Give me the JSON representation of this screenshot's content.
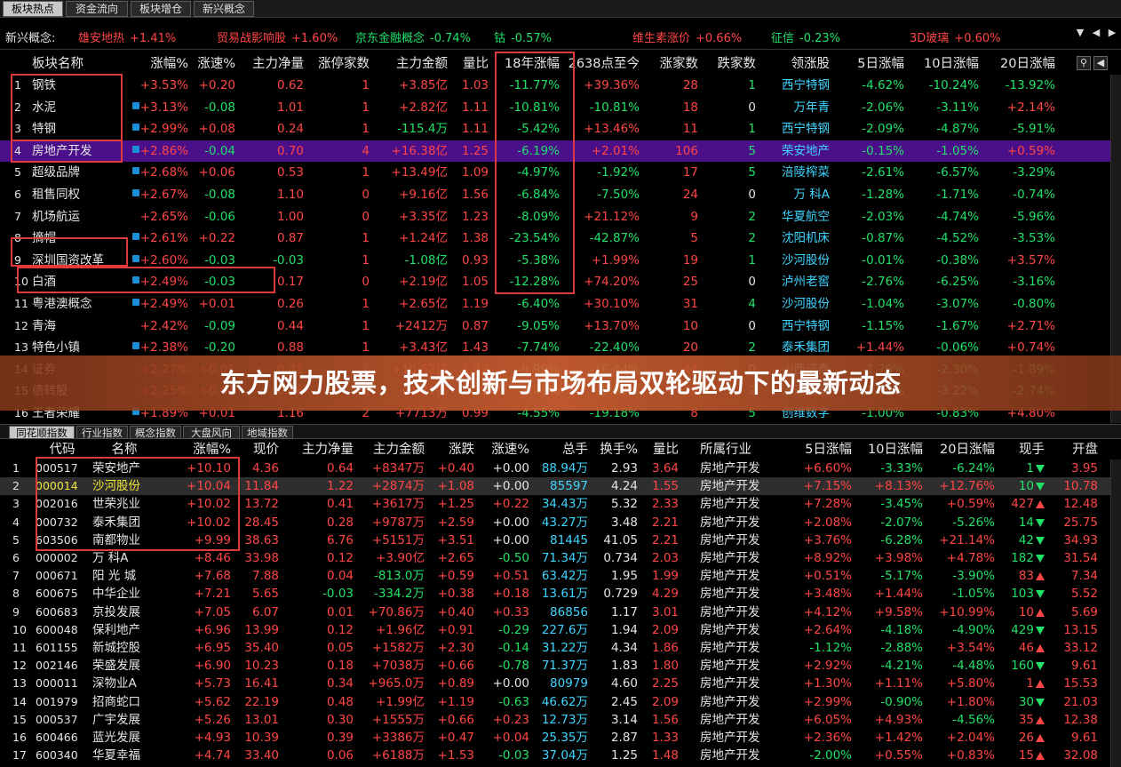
{
  "tabs": [
    "板块热点",
    "资金流向",
    "板块增仓",
    "新兴概念"
  ],
  "ticker": {
    "label": "新兴概念:",
    "items": [
      {
        "name": "雄安地热",
        "value": "+1.41%",
        "name_color": "#ff4646",
        "value_color": "#ff4646"
      },
      {
        "name": "贸易战影响股",
        "value": "+1.60%",
        "name_color": "#ff4646",
        "value_color": "#ff4646"
      },
      {
        "name": "京东金融概念",
        "value": "-0.74%",
        "name_color": "#22e06a",
        "value_color": "#22e06a"
      },
      {
        "name": "钴",
        "value": "-0.57%",
        "name_color": "#22e06a",
        "value_color": "#22e06a"
      },
      {
        "name": "维生素涨价",
        "value": "+0.66%",
        "name_color": "#ff4646",
        "value_color": "#ff4646"
      },
      {
        "name": "征信",
        "value": "-0.23%",
        "name_color": "#22e06a",
        "value_color": "#22e06a"
      },
      {
        "name": "3D玻璃",
        "value": "+0.60%",
        "name_color": "#ff4646",
        "value_color": "#ff4646"
      }
    ]
  },
  "top_headers": [
    "板块名称",
    "涨幅%",
    "涨速%",
    "主力净量",
    "涨停家数",
    "主力金额",
    "量比",
    "18年涨幅",
    "2638点至今",
    "涨家数",
    "跌家数",
    "领涨股",
    "5日涨幅",
    "10日涨幅",
    "20日涨幅"
  ],
  "top_rows": [
    {
      "n": "1",
      "name": "钢铁",
      "dot": false,
      "chg": "+3.53%",
      "spd": "+0.20",
      "net": "0.62",
      "lim": "1",
      "amt": "+3.85亿",
      "vr": "1.03",
      "y18": "-11.77%",
      "p2638": "+39.36%",
      "up": "28",
      "dn": "1",
      "lead": "西宁特钢",
      "d5": "-4.62%",
      "d10": "-10.24%",
      "d20": "-13.92%"
    },
    {
      "n": "2",
      "name": "水泥",
      "dot": true,
      "chg": "+3.13%",
      "spd": "-0.08",
      "net": "1.01",
      "lim": "1",
      "amt": "+2.82亿",
      "vr": "1.11",
      "y18": "-10.81%",
      "p2638": "-10.81%",
      "up": "18",
      "dn": "0",
      "lead": "万年青",
      "d5": "-2.06%",
      "d10": "-3.11%",
      "d20": "+2.14%"
    },
    {
      "n": "3",
      "name": "特钢",
      "dot": true,
      "chg": "+2.99%",
      "spd": "+0.08",
      "net": "0.24",
      "lim": "1",
      "amt": "-115.4万",
      "vr": "1.11",
      "y18": "-5.42%",
      "p2638": "+13.46%",
      "up": "11",
      "dn": "1",
      "lead": "西宁特钢",
      "d5": "-2.09%",
      "d10": "-4.87%",
      "d20": "-5.91%"
    },
    {
      "n": "4",
      "name": "房地产开发",
      "dot": true,
      "chg": "+2.86%",
      "spd": "-0.04",
      "net": "0.70",
      "lim": "4",
      "amt": "+16.38亿",
      "vr": "1.25",
      "y18": "-6.19%",
      "p2638": "+2.01%",
      "up": "106",
      "dn": "5",
      "lead": "荣安地产",
      "d5": "-0.15%",
      "d10": "-1.05%",
      "d20": "+0.59%"
    },
    {
      "n": "5",
      "name": "超级品牌",
      "dot": true,
      "chg": "+2.68%",
      "spd": "+0.06",
      "net": "0.53",
      "lim": "1",
      "amt": "+13.49亿",
      "vr": "1.09",
      "y18": "-4.97%",
      "p2638": "-1.92%",
      "up": "17",
      "dn": "5",
      "lead": "涪陵榨菜",
      "d5": "-2.61%",
      "d10": "-6.57%",
      "d20": "-3.29%"
    },
    {
      "n": "6",
      "name": "租售同权",
      "dot": true,
      "chg": "+2.67%",
      "spd": "-0.08",
      "net": "1.10",
      "lim": "0",
      "amt": "+9.16亿",
      "vr": "1.56",
      "y18": "-6.84%",
      "p2638": "-7.50%",
      "up": "24",
      "dn": "0",
      "lead": "万 科A",
      "d5": "-1.28%",
      "d10": "-1.71%",
      "d20": "-0.74%"
    },
    {
      "n": "7",
      "name": "机场航运",
      "dot": false,
      "chg": "+2.65%",
      "spd": "-0.06",
      "net": "1.00",
      "lim": "0",
      "amt": "+3.35亿",
      "vr": "1.23",
      "y18": "-8.09%",
      "p2638": "+21.12%",
      "up": "9",
      "dn": "2",
      "lead": "华夏航空",
      "d5": "-2.03%",
      "d10": "-4.74%",
      "d20": "-5.96%"
    },
    {
      "n": "8",
      "name": "摘帽",
      "dot": true,
      "chg": "+2.61%",
      "spd": "+0.22",
      "net": "0.87",
      "lim": "1",
      "amt": "+1.24亿",
      "vr": "1.38",
      "y18": "-23.54%",
      "p2638": "-42.87%",
      "up": "5",
      "dn": "2",
      "lead": "沈阳机床",
      "d5": "-0.87%",
      "d10": "-4.52%",
      "d20": "-3.53%"
    },
    {
      "n": "9",
      "name": "深圳国资改革",
      "dot": true,
      "chg": "+2.60%",
      "spd": "-0.03",
      "net": "-0.03",
      "lim": "1",
      "amt": "-1.08亿",
      "vr": "0.93",
      "y18": "-5.38%",
      "p2638": "+1.99%",
      "up": "19",
      "dn": "1",
      "lead": "沙河股份",
      "d5": "-0.01%",
      "d10": "-0.38%",
      "d20": "+3.57%"
    },
    {
      "n": "10",
      "name": "白酒",
      "dot": true,
      "chg": "+2.49%",
      "spd": "-0.03",
      "net": "0.17",
      "lim": "0",
      "amt": "+2.19亿",
      "vr": "1.05",
      "y18": "-12.28%",
      "p2638": "+74.20%",
      "up": "25",
      "dn": "0",
      "lead": "泸州老窖",
      "d5": "-2.76%",
      "d10": "-6.25%",
      "d20": "-3.16%"
    },
    {
      "n": "11",
      "name": "粤港澳概念",
      "dot": true,
      "chg": "+2.49%",
      "spd": "+0.01",
      "net": "0.26",
      "lim": "1",
      "amt": "+2.65亿",
      "vr": "1.19",
      "y18": "-6.40%",
      "p2638": "+30.10%",
      "up": "31",
      "dn": "4",
      "lead": "沙河股份",
      "d5": "-1.04%",
      "d10": "-3.07%",
      "d20": "-0.80%"
    },
    {
      "n": "12",
      "name": "青海",
      "dot": false,
      "chg": "+2.42%",
      "spd": "-0.09",
      "net": "0.44",
      "lim": "1",
      "amt": "+2412万",
      "vr": "0.87",
      "y18": "-9.05%",
      "p2638": "+13.70%",
      "up": "10",
      "dn": "0",
      "lead": "西宁特钢",
      "d5": "-1.15%",
      "d10": "-1.67%",
      "d20": "+2.71%"
    },
    {
      "n": "13",
      "name": "特色小镇",
      "dot": true,
      "chg": "+2.38%",
      "spd": "-0.20",
      "net": "0.88",
      "lim": "1",
      "amt": "+3.43亿",
      "vr": "1.43",
      "y18": "-7.74%",
      "p2638": "-22.40%",
      "up": "20",
      "dn": "2",
      "lead": "泰禾集团",
      "d5": "+1.44%",
      "d10": "-0.06%",
      "d20": "+0.74%"
    },
    {
      "n": "14",
      "name": "证券",
      "dot": false,
      "chg": "+2.27%",
      "spd": "+0.01",
      "net": "0.41",
      "lim": "1",
      "amt": "+10.52亿",
      "vr": "1.32",
      "y18": "-9.99%",
      "p2638": "-16.44%",
      "up": "44",
      "dn": "0",
      "lead": "山西证券",
      "d5": "-1.70%",
      "d10": "-2.30%",
      "d20": "-1.89%"
    },
    {
      "n": "15",
      "name": "债转股",
      "dot": false,
      "chg": "+2.25%",
      "spd": "+0.01",
      "net": "0.56",
      "lim": "1",
      "amt": "+4.21亿",
      "vr": "1.21",
      "y18": "-8.41%",
      "p2638": "-5.67%",
      "up": "30",
      "dn": "2",
      "lead": "沙河股份",
      "d5": "-1.85%",
      "d10": "-3.22%",
      "d20": "-2.74%"
    },
    {
      "n": "16",
      "name": "王者荣耀",
      "dot": true,
      "chg": "+1.89%",
      "spd": "+0.01",
      "net": "1.16",
      "lim": "2",
      "amt": "+7713万",
      "vr": "0.99",
      "y18": "-4.55%",
      "p2638": "-19.18%",
      "up": "8",
      "dn": "5",
      "lead": "创维数字",
      "d5": "-1.00%",
      "d10": "-0.83%",
      "d20": "+4.80%"
    }
  ],
  "bottom_tabs": [
    "同花顺指数",
    "行业指数",
    "概念指数",
    "大盘风向",
    "地域指数"
  ],
  "bottom_headers": [
    "代码",
    "名称",
    "涨幅%",
    "现价",
    "主力净量",
    "主力金额",
    "涨跌",
    "涨速%",
    "总手",
    "换手%",
    "量比",
    "所属行业",
    "5日涨幅",
    "10日涨幅",
    "20日涨幅",
    "现手",
    "开盘"
  ],
  "bottom_rows": [
    {
      "n": "1",
      "code": "000517",
      "name": "荣安地产",
      "chg": "+10.10",
      "price": "4.36",
      "net": "0.64",
      "amt": "+8347万",
      "diff": "+0.40",
      "spd": "+0.00",
      "vol": "88.94万",
      "turn": "2.93",
      "vr": "3.64",
      "ind": "房地产开发",
      "d5": "+6.60%",
      "d10": "-3.33%",
      "d20": "-6.24%",
      "hand": "1",
      "dir": "down",
      "open": "3.95"
    },
    {
      "n": "2",
      "code": "000014",
      "name": "沙河股份",
      "chg": "+10.04",
      "price": "11.84",
      "net": "1.22",
      "amt": "+2874万",
      "diff": "+1.08",
      "spd": "+0.00",
      "vol": "85597",
      "turn": "4.24",
      "vr": "1.55",
      "ind": "房地产开发",
      "d5": "+7.15%",
      "d10": "+8.13%",
      "d20": "+12.76%",
      "hand": "10",
      "dir": "down",
      "open": "10.78"
    },
    {
      "n": "3",
      "code": "002016",
      "name": "世荣兆业",
      "chg": "+10.02",
      "price": "13.72",
      "net": "0.41",
      "amt": "+3617万",
      "diff": "+1.25",
      "spd": "+0.22",
      "vol": "34.43万",
      "turn": "5.32",
      "vr": "2.33",
      "ind": "房地产开发",
      "d5": "+7.28%",
      "d10": "-3.45%",
      "d20": "+0.59%",
      "hand": "427",
      "dir": "up",
      "open": "12.48"
    },
    {
      "n": "4",
      "code": "000732",
      "name": "泰禾集团",
      "chg": "+10.02",
      "price": "28.45",
      "net": "0.28",
      "amt": "+9787万",
      "diff": "+2.59",
      "spd": "+0.00",
      "vol": "43.27万",
      "turn": "3.48",
      "vr": "2.21",
      "ind": "房地产开发",
      "d5": "+2.08%",
      "d10": "-2.07%",
      "d20": "-5.26%",
      "hand": "14",
      "dir": "down",
      "open": "25.75"
    },
    {
      "n": "5",
      "code": "603506",
      "name": "南都物业",
      "chg": "+9.99",
      "price": "38.63",
      "net": "6.76",
      "amt": "+5151万",
      "diff": "+3.51",
      "spd": "+0.00",
      "vol": "81445",
      "turn": "41.05",
      "vr": "2.21",
      "ind": "房地产开发",
      "d5": "+3.76%",
      "d10": "-6.28%",
      "d20": "+21.14%",
      "hand": "42",
      "dir": "down",
      "open": "34.93"
    },
    {
      "n": "6",
      "code": "000002",
      "name": "万 科A",
      "chg": "+8.46",
      "price": "33.98",
      "net": "0.12",
      "amt": "+3.90亿",
      "diff": "+2.65",
      "spd": "-0.50",
      "vol": "71.34万",
      "turn": "0.734",
      "vr": "2.03",
      "ind": "房地产开发",
      "d5": "+8.92%",
      "d10": "+3.98%",
      "d20": "+4.78%",
      "hand": "182",
      "dir": "down",
      "open": "31.54"
    },
    {
      "n": "7",
      "code": "000671",
      "name": "阳 光 城",
      "chg": "+7.68",
      "price": "7.88",
      "net": "0.04",
      "amt": "-813.0万",
      "diff": "+0.59",
      "spd": "+0.51",
      "vol": "63.42万",
      "turn": "1.95",
      "vr": "1.99",
      "ind": "房地产开发",
      "d5": "+0.51%",
      "d10": "-5.17%",
      "d20": "-3.90%",
      "hand": "83",
      "dir": "up",
      "open": "7.34"
    },
    {
      "n": "8",
      "code": "600675",
      "name": "中华企业",
      "chg": "+7.21",
      "price": "5.65",
      "net": "-0.03",
      "amt": "-334.2万",
      "diff": "+0.38",
      "spd": "+0.18",
      "vol": "13.61万",
      "turn": "0.729",
      "vr": "4.29",
      "ind": "房地产开发",
      "d5": "+3.48%",
      "d10": "+1.44%",
      "d20": "-1.05%",
      "hand": "103",
      "dir": "down",
      "open": "5.52"
    },
    {
      "n": "9",
      "code": "600683",
      "name": "京投发展",
      "chg": "+7.05",
      "price": "6.07",
      "net": "0.01",
      "amt": "+70.86万",
      "diff": "+0.40",
      "spd": "+0.33",
      "vol": "86856",
      "turn": "1.17",
      "vr": "3.01",
      "ind": "房地产开发",
      "d5": "+4.12%",
      "d10": "+9.58%",
      "d20": "+10.99%",
      "hand": "10",
      "dir": "up",
      "open": "5.69"
    },
    {
      "n": "10",
      "code": "600048",
      "name": "保利地产",
      "chg": "+6.96",
      "price": "13.99",
      "net": "0.12",
      "amt": "+1.96亿",
      "diff": "+0.91",
      "spd": "-0.29",
      "vol": "227.6万",
      "turn": "1.94",
      "vr": "2.09",
      "ind": "房地产开发",
      "d5": "+2.64%",
      "d10": "-4.18%",
      "d20": "-4.90%",
      "hand": "429",
      "dir": "down",
      "open": "13.15"
    },
    {
      "n": "11",
      "code": "601155",
      "name": "新城控股",
      "chg": "+6.95",
      "price": "35.40",
      "net": "0.05",
      "amt": "+1582万",
      "diff": "+2.30",
      "spd": "-0.14",
      "vol": "31.22万",
      "turn": "4.34",
      "vr": "1.86",
      "ind": "房地产开发",
      "d5": "-1.12%",
      "d10": "-2.88%",
      "d20": "+3.54%",
      "hand": "46",
      "dir": "up",
      "open": "33.12"
    },
    {
      "n": "12",
      "code": "002146",
      "name": "荣盛发展",
      "chg": "+6.90",
      "price": "10.23",
      "net": "0.18",
      "amt": "+7038万",
      "diff": "+0.66",
      "spd": "-0.78",
      "vol": "71.37万",
      "turn": "1.83",
      "vr": "1.80",
      "ind": "房地产开发",
      "d5": "+2.92%",
      "d10": "-4.21%",
      "d20": "-4.48%",
      "hand": "160",
      "dir": "down",
      "open": "9.61"
    },
    {
      "n": "13",
      "code": "000011",
      "name": "深物业A",
      "chg": "+5.73",
      "price": "16.41",
      "net": "0.34",
      "amt": "+965.0万",
      "diff": "+0.89",
      "spd": "+0.00",
      "vol": "80979",
      "turn": "4.60",
      "vr": "2.25",
      "ind": "房地产开发",
      "d5": "+1.30%",
      "d10": "+1.11%",
      "d20": "+5.80%",
      "hand": "1",
      "dir": "up",
      "open": "15.53"
    },
    {
      "n": "14",
      "code": "001979",
      "name": "招商蛇口",
      "chg": "+5.62",
      "price": "22.19",
      "net": "0.48",
      "amt": "+1.99亿",
      "diff": "+1.19",
      "spd": "-0.63",
      "vol": "46.62万",
      "turn": "2.45",
      "vr": "2.09",
      "ind": "房地产开发",
      "d5": "+2.99%",
      "d10": "-0.90%",
      "d20": "+1.80%",
      "hand": "30",
      "dir": "down",
      "open": "21.03"
    },
    {
      "n": "15",
      "code": "000537",
      "name": "广宇发展",
      "chg": "+5.26",
      "price": "13.01",
      "net": "0.30",
      "amt": "+1555万",
      "diff": "+0.66",
      "spd": "+0.23",
      "vol": "12.73万",
      "turn": "3.14",
      "vr": "1.56",
      "ind": "房地产开发",
      "d5": "+6.05%",
      "d10": "+4.93%",
      "d20": "-4.56%",
      "hand": "35",
      "dir": "up",
      "open": "12.38"
    },
    {
      "n": "16",
      "code": "600466",
      "name": "蓝光发展",
      "chg": "+4.93",
      "price": "10.39",
      "net": "0.39",
      "amt": "+3386万",
      "diff": "+0.47",
      "spd": "+0.04",
      "vol": "25.35万",
      "turn": "2.87",
      "vr": "1.33",
      "ind": "房地产开发",
      "d5": "+2.36%",
      "d10": "+1.42%",
      "d20": "+2.04%",
      "hand": "26",
      "dir": "up",
      "open": "9.61"
    },
    {
      "n": "17",
      "code": "600340",
      "name": "华夏幸福",
      "chg": "+4.74",
      "price": "33.40",
      "net": "0.06",
      "amt": "+6188万",
      "diff": "+1.53",
      "spd": "-0.03",
      "vol": "37.04万",
      "turn": "1.25",
      "vr": "1.48",
      "ind": "房地产开发",
      "d5": "-2.00%",
      "d10": "+0.55%",
      "d20": "+0.83%",
      "hand": "15",
      "dir": "up",
      "open": "32.08"
    }
  ],
  "banner_title": "东方网力股票，技术创新与市场布局双轮驱动下的最新动态"
}
